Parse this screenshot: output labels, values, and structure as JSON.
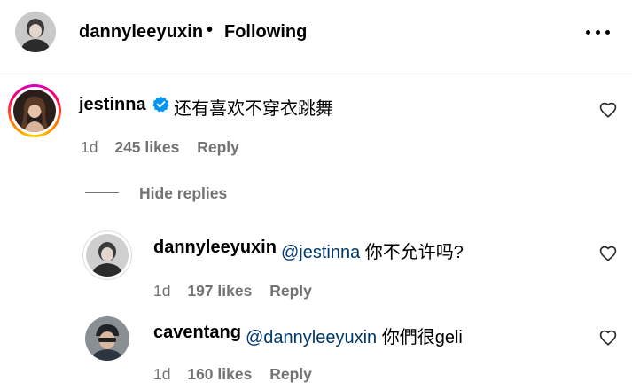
{
  "header": {
    "username": "dannyleeyuxin",
    "separator": "•",
    "follow_state": "Following"
  },
  "comment": {
    "username": "jestinna",
    "verified": true,
    "text": "还有喜欢不穿衣跳舞",
    "time": "1d",
    "likes": "245 likes",
    "reply_label": "Reply"
  },
  "hide_replies_label": "Hide replies",
  "replies": [
    {
      "username": "dannyleeyuxin",
      "mention": "@jestinna",
      "text": " 你不允许吗?",
      "time": "1d",
      "likes": "197 likes",
      "reply_label": "Reply"
    },
    {
      "username": "caventang",
      "mention": "@dannyleeyuxin",
      "text": " 你們很geli",
      "time": "1d",
      "likes": "160 likes",
      "reply_label": "Reply"
    }
  ],
  "icons": {
    "more": "more-horizontal-icon",
    "verified": "verified-badge-icon",
    "like": "heart-outline-icon"
  },
  "colors": {
    "text": "#000000",
    "secondary": "#737373",
    "mention": "#00376b",
    "verified": "#0095f6"
  }
}
